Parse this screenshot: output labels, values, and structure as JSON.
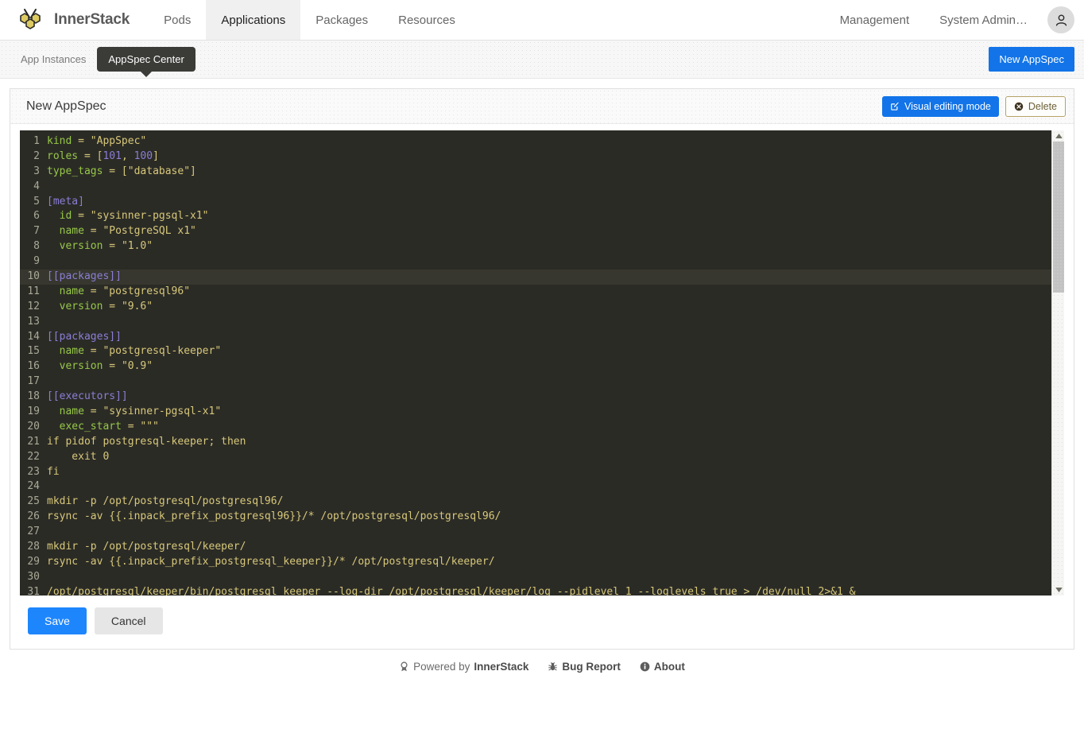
{
  "navbar": {
    "logo_icon": "honeycomb-bee-logo",
    "brand": "InnerStack",
    "left_items": [
      {
        "label": "Pods",
        "active": false
      },
      {
        "label": "Applications",
        "active": true
      },
      {
        "label": "Packages",
        "active": false
      },
      {
        "label": "Resources",
        "active": false
      }
    ],
    "right_items": [
      {
        "label": "Management"
      },
      {
        "label": "System Admin…"
      }
    ],
    "avatar_icon": "user-avatar-icon"
  },
  "subbar": {
    "tabs": [
      {
        "label": "App Instances",
        "active": false
      },
      {
        "label": "AppSpec Center",
        "active": true
      }
    ],
    "new_button": "New AppSpec"
  },
  "panel": {
    "title": "New AppSpec",
    "visual_edit_label": "Visual editing mode",
    "visual_edit_icon": "pencil-square-icon",
    "delete_label": "Delete",
    "delete_icon": "circle-x-icon"
  },
  "editor": {
    "language": "toml",
    "active_line": 10,
    "scrollbar": {
      "up_icon": "scroll-up-arrow-icon",
      "down_icon": "scroll-down-arrow-icon",
      "thumb_position_pct": 0,
      "thumb_size_pct": 33
    },
    "lines": [
      {
        "n": 1,
        "tokens": [
          {
            "t": "key",
            "v": "kind"
          },
          {
            "t": "op",
            "v": " = "
          },
          {
            "t": "str",
            "v": "\"AppSpec\""
          }
        ]
      },
      {
        "n": 2,
        "tokens": [
          {
            "t": "key",
            "v": "roles"
          },
          {
            "t": "op",
            "v": " = ["
          },
          {
            "t": "num",
            "v": "101"
          },
          {
            "t": "op",
            "v": ", "
          },
          {
            "t": "num",
            "v": "100"
          },
          {
            "t": "op",
            "v": "]"
          }
        ]
      },
      {
        "n": 3,
        "tokens": [
          {
            "t": "key",
            "v": "type_tags"
          },
          {
            "t": "op",
            "v": " = ["
          },
          {
            "t": "str",
            "v": "\"database\""
          },
          {
            "t": "op",
            "v": "]"
          }
        ]
      },
      {
        "n": 4,
        "tokens": []
      },
      {
        "n": 5,
        "tokens": [
          {
            "t": "sec",
            "v": "[meta]"
          }
        ]
      },
      {
        "n": 6,
        "tokens": [
          {
            "t": "key",
            "v": "  id"
          },
          {
            "t": "op",
            "v": " = "
          },
          {
            "t": "str",
            "v": "\"sysinner-pgsql-x1\""
          }
        ]
      },
      {
        "n": 7,
        "tokens": [
          {
            "t": "key",
            "v": "  name"
          },
          {
            "t": "op",
            "v": " = "
          },
          {
            "t": "str",
            "v": "\"PostgreSQL x1\""
          }
        ]
      },
      {
        "n": 8,
        "tokens": [
          {
            "t": "key",
            "v": "  version"
          },
          {
            "t": "op",
            "v": " = "
          },
          {
            "t": "str",
            "v": "\"1.0\""
          }
        ]
      },
      {
        "n": 9,
        "tokens": []
      },
      {
        "n": 10,
        "tokens": [
          {
            "t": "sec",
            "v": "[[packages]]"
          }
        ]
      },
      {
        "n": 11,
        "tokens": [
          {
            "t": "key",
            "v": "  name"
          },
          {
            "t": "op",
            "v": " = "
          },
          {
            "t": "str",
            "v": "\"postgresql96\""
          }
        ]
      },
      {
        "n": 12,
        "tokens": [
          {
            "t": "key",
            "v": "  version"
          },
          {
            "t": "op",
            "v": " = "
          },
          {
            "t": "str",
            "v": "\"9.6\""
          }
        ]
      },
      {
        "n": 13,
        "tokens": []
      },
      {
        "n": 14,
        "tokens": [
          {
            "t": "sec",
            "v": "[[packages]]"
          }
        ]
      },
      {
        "n": 15,
        "tokens": [
          {
            "t": "key",
            "v": "  name"
          },
          {
            "t": "op",
            "v": " = "
          },
          {
            "t": "str",
            "v": "\"postgresql-keeper\""
          }
        ]
      },
      {
        "n": 16,
        "tokens": [
          {
            "t": "key",
            "v": "  version"
          },
          {
            "t": "op",
            "v": " = "
          },
          {
            "t": "str",
            "v": "\"0.9\""
          }
        ]
      },
      {
        "n": 17,
        "tokens": []
      },
      {
        "n": 18,
        "tokens": [
          {
            "t": "sec",
            "v": "[[executors]]"
          }
        ]
      },
      {
        "n": 19,
        "tokens": [
          {
            "t": "key",
            "v": "  name"
          },
          {
            "t": "op",
            "v": " = "
          },
          {
            "t": "str",
            "v": "\"sysinner-pgsql-x1\""
          }
        ]
      },
      {
        "n": 20,
        "tokens": [
          {
            "t": "key",
            "v": "  exec_start"
          },
          {
            "t": "op",
            "v": " = "
          },
          {
            "t": "str",
            "v": "\"\"\""
          }
        ]
      },
      {
        "n": 21,
        "tokens": [
          {
            "t": "plain",
            "v": "if pidof postgresql-keeper; then"
          }
        ]
      },
      {
        "n": 22,
        "tokens": [
          {
            "t": "plain",
            "v": "    exit 0"
          }
        ]
      },
      {
        "n": 23,
        "tokens": [
          {
            "t": "plain",
            "v": "fi"
          }
        ]
      },
      {
        "n": 24,
        "tokens": []
      },
      {
        "n": 25,
        "tokens": [
          {
            "t": "plain",
            "v": "mkdir -p /opt/postgresql/postgresql96/"
          }
        ]
      },
      {
        "n": 26,
        "tokens": [
          {
            "t": "plain",
            "v": "rsync -av {{.inpack_prefix_postgresql96}}/* /opt/postgresql/postgresql96/"
          }
        ]
      },
      {
        "n": 27,
        "tokens": []
      },
      {
        "n": 28,
        "tokens": [
          {
            "t": "plain",
            "v": "mkdir -p /opt/postgresql/keeper/"
          }
        ]
      },
      {
        "n": 29,
        "tokens": [
          {
            "t": "plain",
            "v": "rsync -av {{.inpack_prefix_postgresql_keeper}}/* /opt/postgresql/keeper/"
          }
        ]
      },
      {
        "n": 30,
        "tokens": []
      },
      {
        "n": 31,
        "tokens": [
          {
            "t": "plain",
            "v": "/opt/postgresql/keeper/bin/postgresql_keeper --log-dir /opt/postgresql/keeper/log --pidlevel 1 --loglevels true > /dev/null 2>&1 &"
          }
        ]
      }
    ]
  },
  "form_actions": {
    "save": "Save",
    "cancel": "Cancel"
  },
  "footer": {
    "powered_prefix": "Powered by ",
    "powered_brand": "InnerStack",
    "powered_icon": "ribbon-award-icon",
    "bug_report": "Bug Report",
    "bug_icon": "bug-icon",
    "about": "About",
    "about_icon": "info-circle-icon"
  },
  "colors": {
    "accent_blue": "#1274e8",
    "save_blue": "#1e86fd",
    "editor_bg": "#2b2b26",
    "editor_key": "#96c847",
    "editor_string": "#d7c87a",
    "editor_number": "#8b7ed6",
    "editor_section": "#8b7ed6",
    "logo_yellow": "#d9c65c",
    "delete_border": "#b6a36a",
    "dark_tab": "#3b3b38"
  }
}
